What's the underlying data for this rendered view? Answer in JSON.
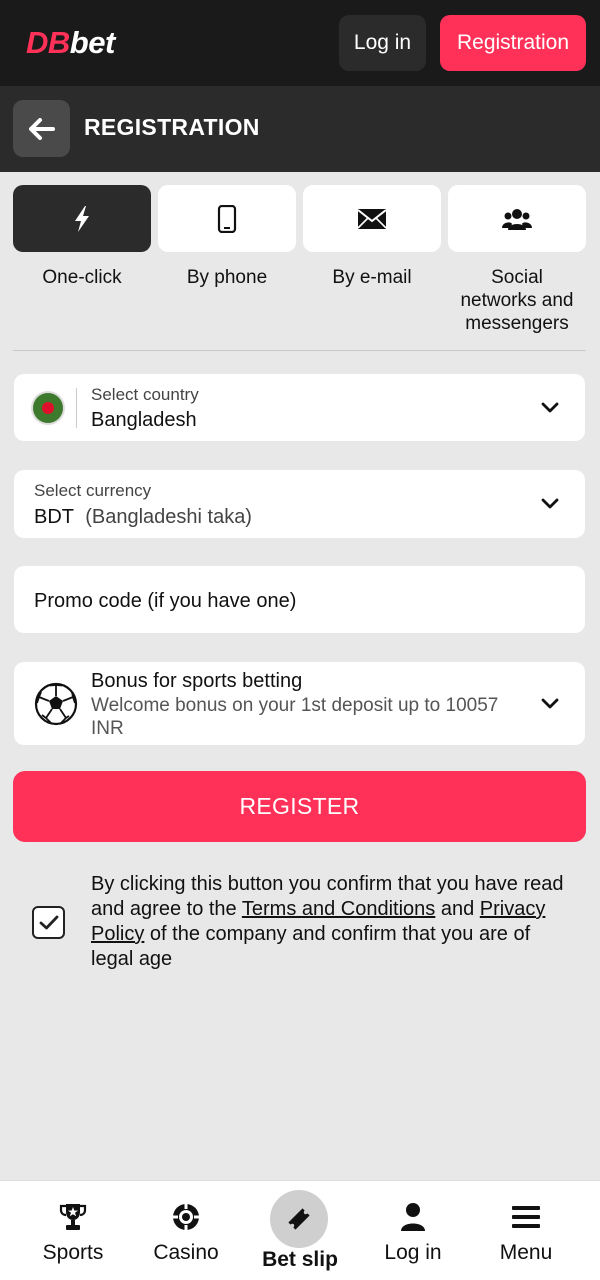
{
  "header": {
    "logo_db": "DB",
    "logo_bet": "bet",
    "login_label": "Log in",
    "registration_label": "Registration"
  },
  "subheader": {
    "title": "REGISTRATION"
  },
  "tabs": [
    {
      "label": "One-click",
      "icon": "lightning-icon",
      "active": true
    },
    {
      "label": "By phone",
      "icon": "phone-icon",
      "active": false
    },
    {
      "label": "By e-mail",
      "icon": "envelope-icon",
      "active": false
    },
    {
      "label": "Social networks and messengers",
      "icon": "users-icon",
      "active": false
    }
  ],
  "form": {
    "country": {
      "label": "Select country",
      "value": "Bangladesh"
    },
    "currency": {
      "label": "Select currency",
      "code": "BDT",
      "name": "(Bangladeshi taka)"
    },
    "promo": {
      "placeholder": "Promo code (if you have one)"
    },
    "bonus": {
      "title": "Bonus for sports betting",
      "description": "Welcome bonus on your 1st deposit up to 10057 INR"
    },
    "register_label": "REGISTER"
  },
  "consent": {
    "checked": true,
    "text_before": "By clicking this button you confirm that you have read and agree to the ",
    "terms_link": "Terms and Conditions",
    "text_and": " and ",
    "privacy_link": "Privacy Policy",
    "text_after": " of the company and confirm that you are of legal age"
  },
  "bottom_nav": {
    "sports": "Sports",
    "casino": "Casino",
    "betslip": "Bet slip",
    "login": "Log in",
    "menu": "Menu"
  },
  "colors": {
    "accent": "#ff3158",
    "dark": "#1a1a1a",
    "panel": "#2b2b2b",
    "background": "#e8e8e8"
  }
}
